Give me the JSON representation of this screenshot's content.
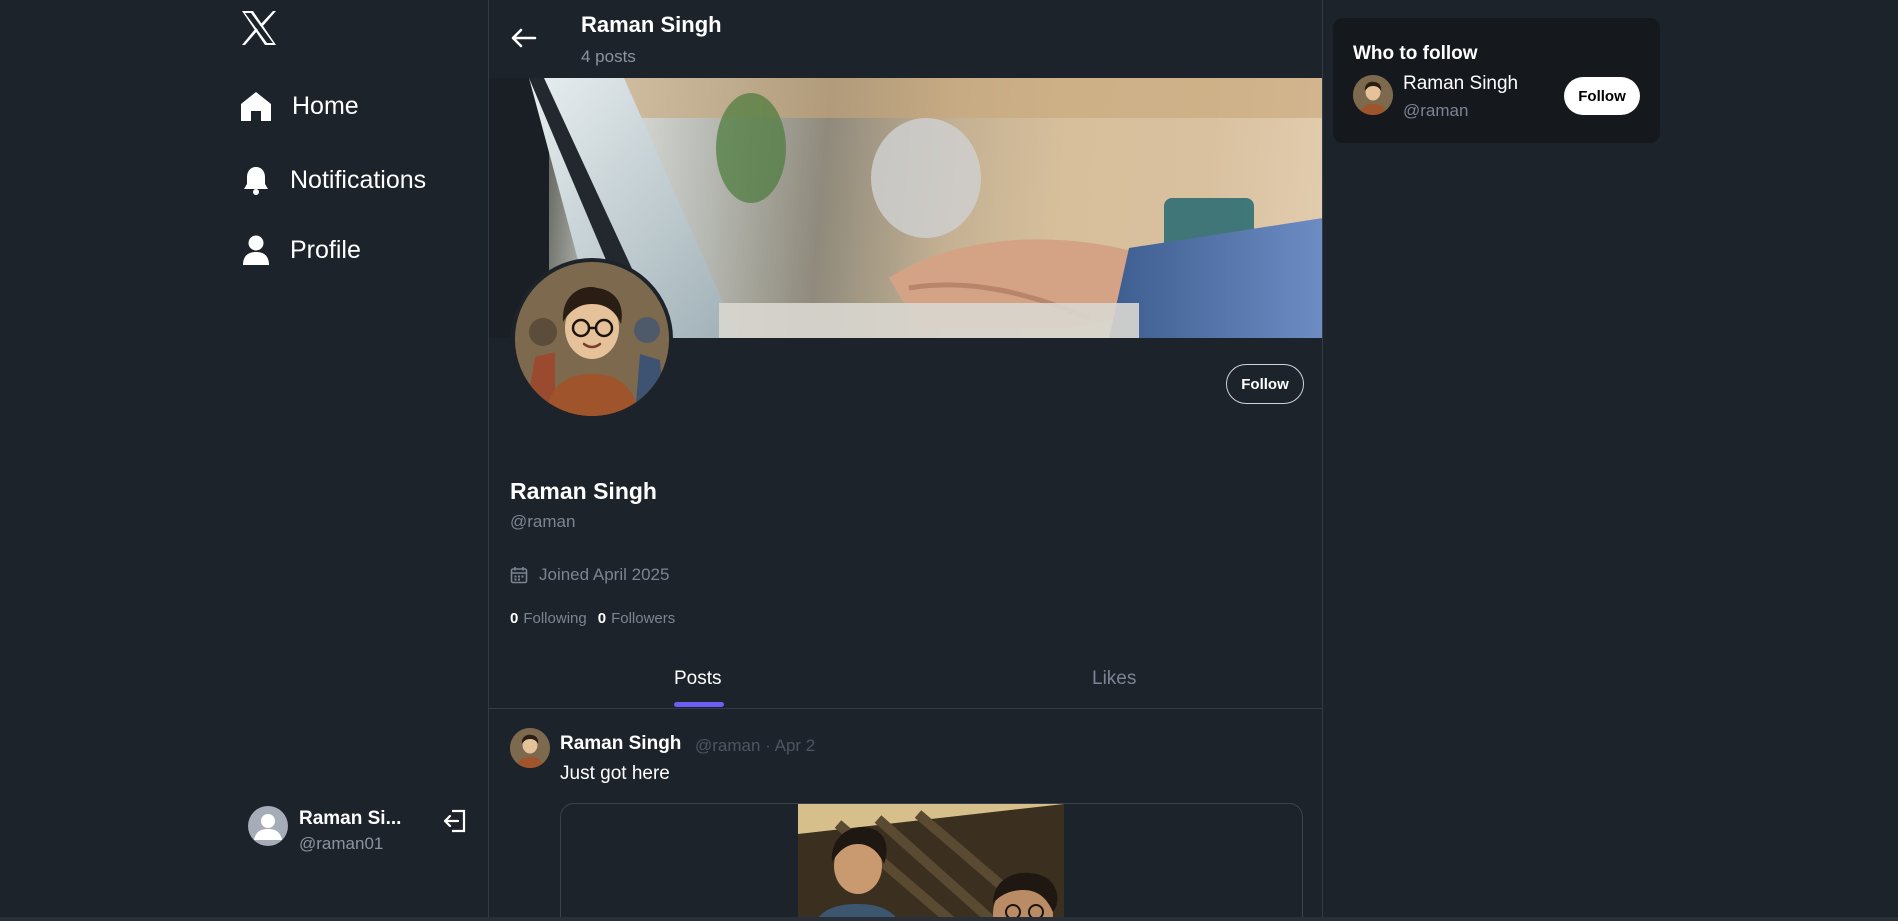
{
  "nav": {
    "items": [
      {
        "label": "Home",
        "icon": "home-icon"
      },
      {
        "label": "Notifications",
        "icon": "bell-icon"
      },
      {
        "label": "Profile",
        "icon": "user-icon"
      }
    ]
  },
  "current_user": {
    "name": "Raman Si...",
    "handle": "@raman01"
  },
  "header": {
    "title": "Raman Singh",
    "subtitle": "4 posts"
  },
  "profile": {
    "name": "Raman Singh",
    "handle": "@raman",
    "joined": "Joined April 2025",
    "following_count": "0",
    "following_label": "Following",
    "followers_count": "0",
    "followers_label": "Followers",
    "follow_label": "Follow"
  },
  "tabs": [
    {
      "label": "Posts",
      "active": true
    },
    {
      "label": "Likes",
      "active": false
    }
  ],
  "posts": [
    {
      "author": "Raman Singh",
      "meta": "@raman · Apr 2",
      "text": "Just got here"
    }
  ],
  "who_to_follow": {
    "title": "Who to follow",
    "users": [
      {
        "name": "Raman Singh",
        "handle": "@raman",
        "button": "Follow"
      }
    ]
  },
  "colors": {
    "background": "#1d232a",
    "panel": "#15191e",
    "accent": "#6f5cf2",
    "muted_text": "#7b8493",
    "border": "#333b45"
  }
}
